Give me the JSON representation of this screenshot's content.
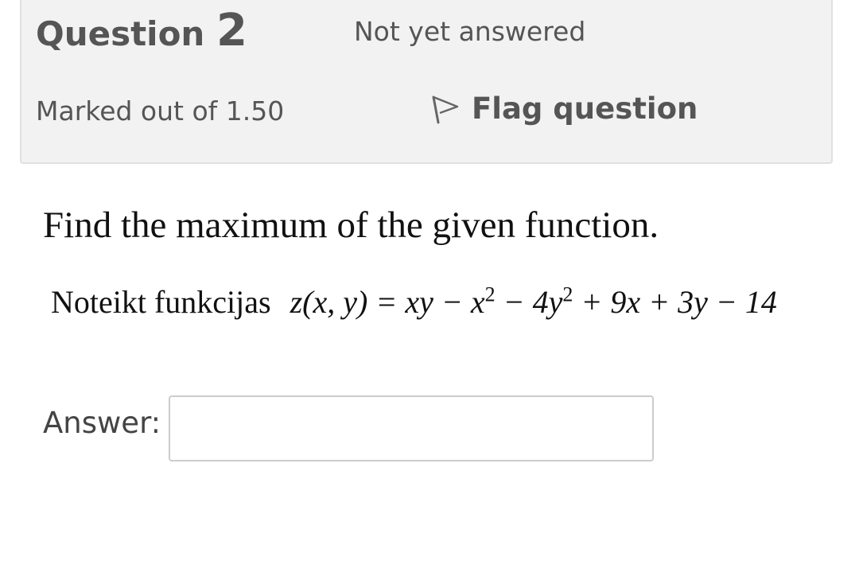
{
  "question": {
    "label_prefix": "Question",
    "number": "2",
    "state": "Not yet answered",
    "grade": "Marked out of 1.50",
    "flag_label": "Flag question",
    "flag_icon": "flag-outline-icon"
  },
  "content": {
    "prompt": "Find the maximum of the given function.",
    "formula_label": "Noteikt funkcijas",
    "formula_expr_html": "z(x, y) = xy − x<sup>2</sup> − 4y<sup>2</sup> + 9x + 3y − 14"
  },
  "answer": {
    "label": "Answer:",
    "value": "",
    "placeholder": ""
  }
}
